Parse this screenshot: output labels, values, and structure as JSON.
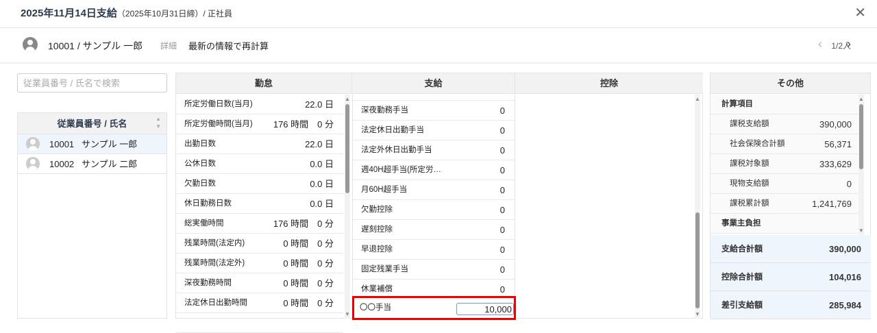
{
  "header": {
    "title": "2025年11月14日支給",
    "subtitle": "（2025年10月31日締）/ 正社員",
    "close_icon": "close-icon"
  },
  "employee_bar": {
    "employee": "10001 / サンプル 一郎",
    "detail_link": "詳細",
    "recalc_button": "最新の情報で再計算",
    "pager": "1/2人",
    "prev": "‹",
    "next": "›"
  },
  "sidebar": {
    "search_placeholder": "従業員番号 / 氏名で検索",
    "column_header": "従業員番号 / 氏名",
    "employees": [
      {
        "id": "10001",
        "name": "サンプル 一郎",
        "selected": true
      },
      {
        "id": "10002",
        "name": "サンプル 二郎",
        "selected": false
      }
    ]
  },
  "columns": {
    "attendance": "勤怠",
    "payment": "支給",
    "deduction": "控除",
    "other": "その他"
  },
  "attendance": [
    {
      "label": "所定労働日数(当月)",
      "value": "22.0 日"
    },
    {
      "label": "所定労働時間(当月)",
      "value": "176 時間　0 分"
    },
    {
      "label": "出勤日数",
      "value": "22.0 日"
    },
    {
      "label": "公休日数",
      "value": "0.0 日"
    },
    {
      "label": "欠勤日数",
      "value": "0.0 日"
    },
    {
      "label": "休日勤務日数",
      "value": "0.0 日"
    },
    {
      "label": "総実働時間",
      "value": "176 時間　0 分"
    },
    {
      "label": "残業時間(法定内)",
      "value": "0 時間　0 分"
    },
    {
      "label": "残業時間(法定外)",
      "value": "0 時間　0 分"
    },
    {
      "label": "深夜勤務時間",
      "value": "0 時間　0 分"
    },
    {
      "label": "法定休日出勤時間",
      "value": "0 時間　0 分"
    }
  ],
  "payment": [
    {
      "label": "深夜勤務手当",
      "value": "0"
    },
    {
      "label": "法定休日出勤手当",
      "value": "0"
    },
    {
      "label": "法定外休日出勤手当",
      "value": "0"
    },
    {
      "label": "週40H超手当(所定労…",
      "value": "0"
    },
    {
      "label": "月60H超手当",
      "value": "0"
    },
    {
      "label": "欠勤控除",
      "value": "0"
    },
    {
      "label": "遅刻控除",
      "value": "0"
    },
    {
      "label": "早退控除",
      "value": "0"
    },
    {
      "label": "固定残業手当",
      "value": "0"
    },
    {
      "label": "休業補償",
      "value": "0"
    }
  ],
  "payment_edit": {
    "label": "〇〇手当",
    "value": "10,000"
  },
  "other": {
    "group1": "計算項目",
    "items": [
      {
        "label": "課税支給額",
        "value": "390,000"
      },
      {
        "label": "社会保険合計額",
        "value": "56,371"
      },
      {
        "label": "課税対象額",
        "value": "333,629"
      },
      {
        "label": "現物支給額",
        "value": "0"
      },
      {
        "label": "課税累計額",
        "value": "1,241,769"
      }
    ],
    "group2": "事業主負担"
  },
  "totals": [
    {
      "label": "支給合計額",
      "value": "390,000"
    },
    {
      "label": "控除合計額",
      "value": "104,016"
    },
    {
      "label": "差引支給額",
      "value": "285,984"
    }
  ],
  "colors": {
    "highlight": "#ee0000",
    "selected_row": "#eef5fd"
  }
}
